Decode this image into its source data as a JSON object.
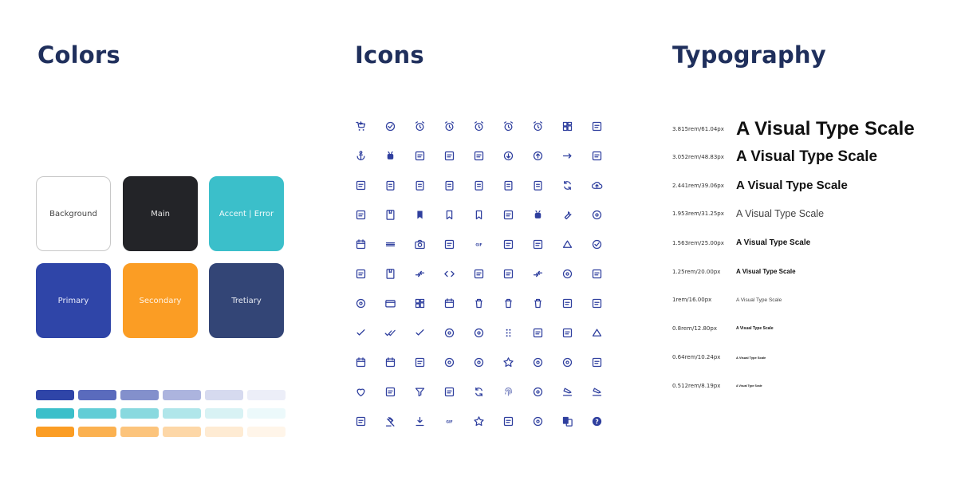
{
  "sections": {
    "colors": "Colors",
    "icons": "Icons",
    "typography": "Typography"
  },
  "colors": {
    "swatches": [
      {
        "label": "Background",
        "color": "#ffffff",
        "text_color": "#444444",
        "border": "#c8c8c8"
      },
      {
        "label": "Main",
        "color": "#232428",
        "text_color": "#e6e6e6",
        "border": "#232428"
      },
      {
        "label": "Accent | Error",
        "color": "#3bbfca",
        "text_color": "#f2fbfc",
        "border": "#3bbfca"
      },
      {
        "label": "Primary",
        "color": "#2f45a8",
        "text_color": "#e8ebfa",
        "border": "#2f45a8"
      },
      {
        "label": "Secondary",
        "color": "#fb9d24",
        "text_color": "#fff4e6",
        "border": "#fb9d24"
      },
      {
        "label": "Tretiary",
        "color": "#334576",
        "text_color": "#e6e9f2",
        "border": "#334576"
      }
    ],
    "tints": [
      [
        "#2f45a8",
        "#5a6bbd",
        "#8390cc",
        "#acb4de",
        "#d6daef",
        "#eceef8"
      ],
      [
        "#3bbfca",
        "#62cdd6",
        "#89d9df",
        "#b0e6ea",
        "#d8f2f4",
        "#ecf9fb"
      ],
      [
        "#fb9d24",
        "#fbb150",
        "#fcc47c",
        "#fdd7a7",
        "#feebd3",
        "#fff5e9"
      ]
    ]
  },
  "icons": {
    "color": "#2f3f9e",
    "items": [
      "cart-add-icon",
      "check-circle-add-icon",
      "clock-badge-icon",
      "alarm-icon",
      "alarm-add-icon",
      "alarm-off-icon",
      "alarm-check-icon",
      "dashboard-panel-icon",
      "focus-frame-icon",
      "anchor-icon",
      "android-icon",
      "feedback-icon",
      "move-arrows-icon",
      "phone-lock-icon",
      "arrow-down-circle-icon",
      "arrow-up-circle-icon",
      "arrow-right-icon",
      "article-icon",
      "chart-box-icon",
      "clipboard-list-icon",
      "clipboard-account-icon",
      "clipboard-alert-icon",
      "clipboard-arrow-left-icon",
      "clipboard-arrow-down-icon",
      "clipboard-check-icon",
      "sync-icon",
      "cloud-upload-icon",
      "bottle-icon",
      "book-icon",
      "bookmark-filled-icon",
      "bookmarks-icon",
      "bookmark-outline-icon",
      "device-list-icon",
      "bug-icon",
      "wrench-icon",
      "wrench-circle-icon",
      "calendar-icon",
      "layers-flat-icon",
      "camera-icon",
      "scissors-disc-icon",
      "card-giftcard-icon",
      "card-membership-icon",
      "briefcase-icon",
      "triangle-icon",
      "check-circle-icon",
      "view-sidebar-icon",
      "book-closed-icon",
      "collapse-icon",
      "code-icon",
      "comment-icon",
      "commute-icon",
      "compare-arrows-icon",
      "contactless-icon",
      "contact-file-icon",
      "copyright-icon",
      "credit-card-icon",
      "dashboard-icon",
      "date-range-icon",
      "delete-icon",
      "delete-forever-icon",
      "delete-outline-icon",
      "description-icon",
      "close-box-icon",
      "done-icon",
      "done-all-icon",
      "done-outline-icon",
      "donut-large-icon",
      "donut-small-icon",
      "drag-indicator-icon",
      "dynamic-form-icon",
      "eco-leaf-icon",
      "eject-icon",
      "event-icon",
      "event-seat-icon",
      "exit-to-app-icon",
      "explore-icon",
      "explore-off-icon",
      "extension-icon",
      "face-icon",
      "face-outline-icon",
      "fact-check-icon",
      "favorite-icon",
      "feedback-outline-icon",
      "filter-icon",
      "find-in-page-icon",
      "find-replace-icon",
      "fingerprint-icon",
      "flaky-icon",
      "flight-land-icon",
      "flight-takeoff-icon",
      "flip-to-back-icon",
      "gavel-icon",
      "get-app-icon",
      "gif-icon",
      "grade-icon",
      "grading-icon",
      "group-work-icon",
      "g-translate-icon",
      "help-icon"
    ]
  },
  "typography": {
    "rows": [
      {
        "label": "3.815rem/61.04px",
        "sample": "A Visual Type Scale"
      },
      {
        "label": "3.052rem/48.83px",
        "sample": "A Visual Type Scale"
      },
      {
        "label": "2.441rem/39.06px",
        "sample": "A Visual Type Scale"
      },
      {
        "label": "1.953rem/31.25px",
        "sample": "A Visual Type Scale"
      },
      {
        "label": "1.563rem/25.00px",
        "sample": "A Visual Type Scale"
      },
      {
        "label": "1.25rem/20.00px",
        "sample": "A Visual Type Scale"
      },
      {
        "label": "1rem/16.00px",
        "sample": "A Visual Type Scale"
      },
      {
        "label": "0.8rem/12.80px",
        "sample": "A Visual Type Scale"
      },
      {
        "label": "0.64rem/10.24px",
        "sample": "A Visual Type Scale"
      },
      {
        "label": "0.512rem/8.19px",
        "sample": "A Visual Type Scale"
      }
    ]
  }
}
